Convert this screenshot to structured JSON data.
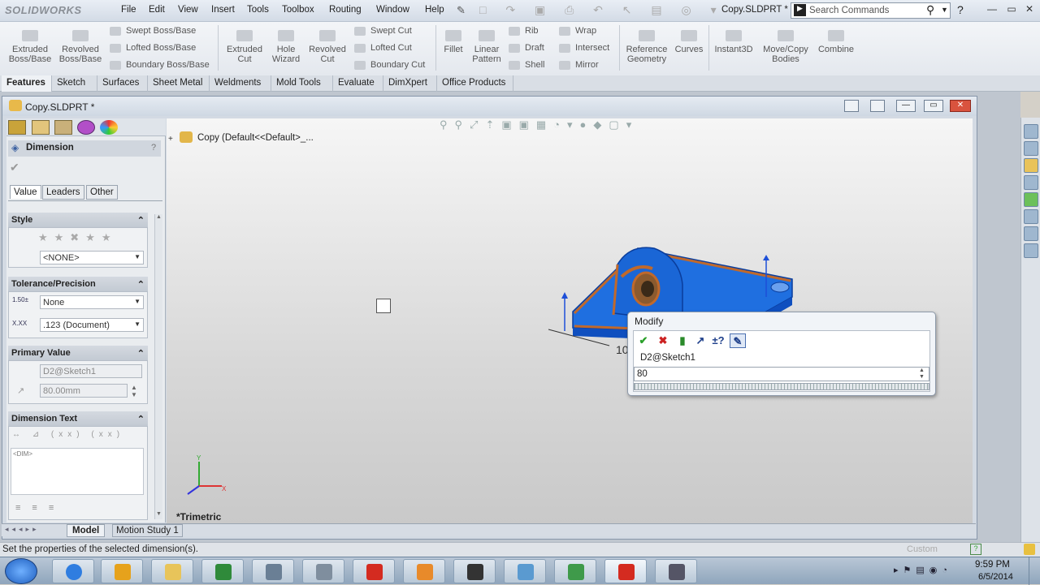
{
  "app": {
    "brand": "SOLIDWORKS",
    "menu": [
      "File",
      "Edit",
      "View",
      "Insert",
      "Tools",
      "Toolbox",
      "Routing",
      "Window",
      "Help"
    ],
    "doc_title": "Copy.SLDPRT *",
    "search_placeholder": "Search Commands"
  },
  "ribbon": {
    "big": [
      {
        "label": "Extruded\nBoss/Base"
      },
      {
        "label": "Revolved\nBoss/Base"
      },
      {
        "label": "Extruded\nCut"
      },
      {
        "label": "Hole\nWizard"
      },
      {
        "label": "Revolved\nCut"
      },
      {
        "label": "Fillet"
      },
      {
        "label": "Linear\nPattern"
      },
      {
        "label": "Reference\nGeometry"
      },
      {
        "label": "Curves"
      },
      {
        "label": "Instant3D"
      },
      {
        "label": "Move/Copy\nBodies"
      },
      {
        "label": "Combine"
      }
    ],
    "small": {
      "boss": [
        "Swept Boss/Base",
        "Lofted Boss/Base",
        "Boundary Boss/Base"
      ],
      "cut": [
        "Swept Cut",
        "Lofted Cut",
        "Boundary Cut"
      ],
      "feat": [
        "Rib",
        "Draft",
        "Shell"
      ],
      "feat2": [
        "Wrap",
        "Intersect",
        "Mirror"
      ]
    }
  },
  "cm_tabs": [
    "Features",
    "Sketch",
    "Surfaces",
    "Sheet Metal",
    "Weldments",
    "Mold Tools",
    "Evaluate",
    "DimXpert",
    "Office Products"
  ],
  "doc": {
    "name": "Copy.SLDPRT *",
    "tree_label": "Copy  (Default<<Default>_..."
  },
  "panel": {
    "title": "Dimension",
    "tabs": [
      "Value",
      "Leaders",
      "Other"
    ],
    "style": {
      "header": "Style",
      "dropdown": "<NONE>"
    },
    "tolerance": {
      "header": "Tolerance/Precision",
      "tol": "None",
      "prec": ".123 (Document)"
    },
    "primary": {
      "header": "Primary Value",
      "name": "D2@Sketch1",
      "value": "80.00mm"
    },
    "dimtext": {
      "header": "Dimension Text",
      "box": "<DIM>"
    }
  },
  "viewport": {
    "view_name": "*Trimetric",
    "dim_fragment": "10"
  },
  "modify": {
    "title": "Modify",
    "name": "D2@Sketch1",
    "value": "80"
  },
  "bottom_tabs": [
    "Model",
    "Motion Study 1"
  ],
  "status": {
    "text": "Set the properties of the selected dimension(s).",
    "right": "Custom"
  },
  "clock": {
    "time": "9:59 PM",
    "date": "6/5/2014"
  },
  "colors": {
    "model_blue": "#1f6fe0",
    "edge_orange": "#c0692b",
    "accept": "#2aa02a",
    "cancel": "#cc2222"
  }
}
